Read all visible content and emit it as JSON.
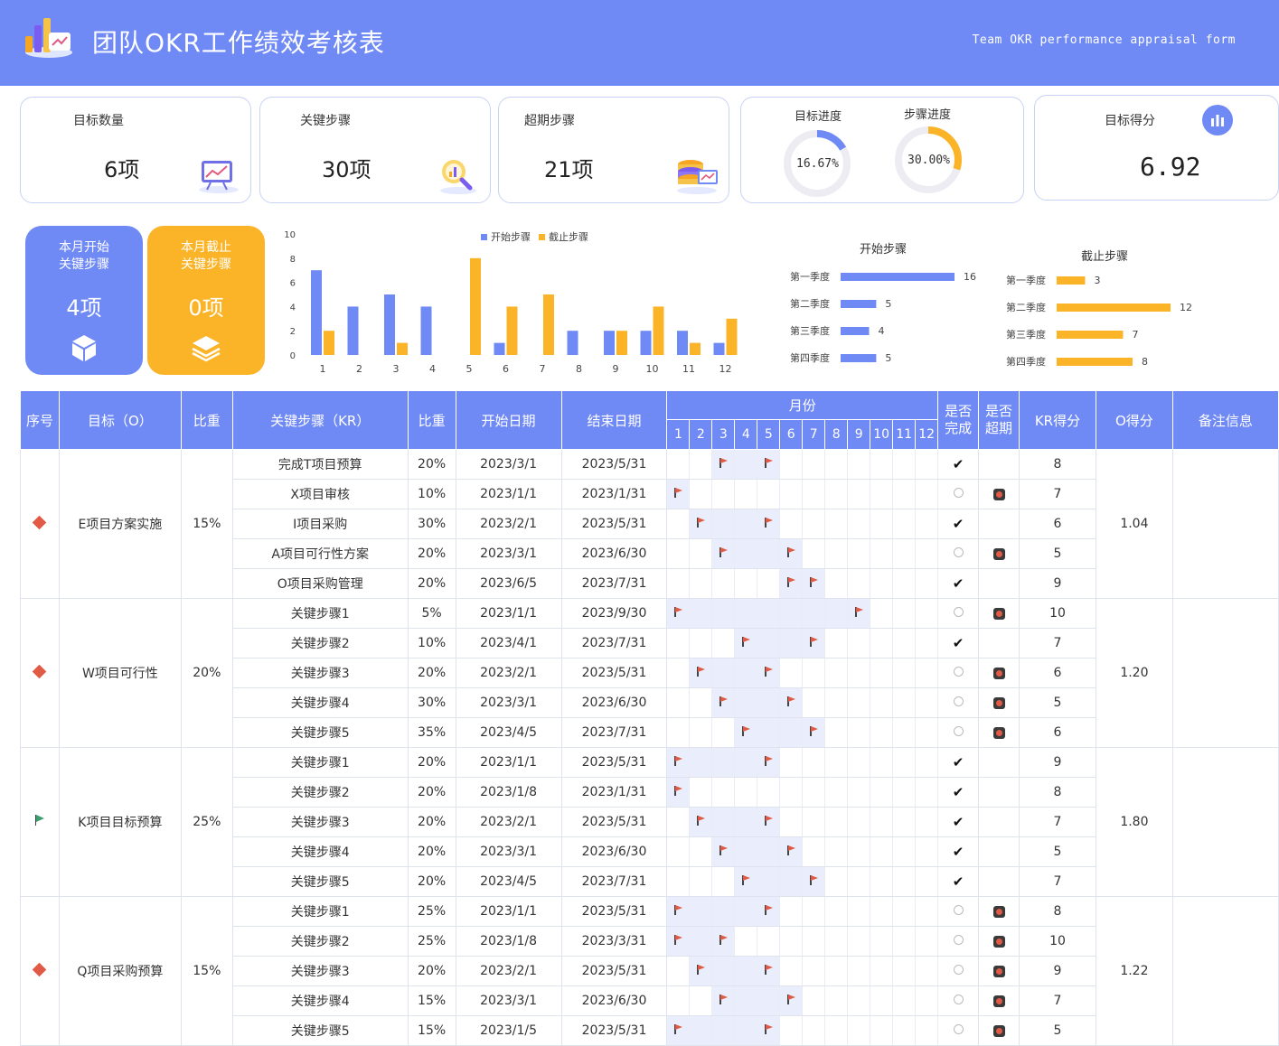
{
  "header": {
    "title": "团队OKR工作绩效考核表",
    "subtitle": "Team OKR performance appraisal form"
  },
  "stats": {
    "goal_count": {
      "label": "目标数量",
      "value": "6项"
    },
    "key_steps": {
      "label": "关键步骤",
      "value": "30项"
    },
    "overdue_steps": {
      "label": "超期步骤",
      "value": "21项"
    },
    "goal_progress": {
      "label": "目标进度",
      "value": "16.67%",
      "fraction": 0.1667
    },
    "step_progress": {
      "label": "步骤进度",
      "value": "30.00%",
      "fraction": 0.3
    },
    "goal_score": {
      "label": "目标得分",
      "value": "6.92"
    }
  },
  "month_boxes": {
    "start": {
      "label1": "本月开始",
      "label2": "关键步骤",
      "value": "4项"
    },
    "end": {
      "label1": "本月截止",
      "label2": "关键步骤",
      "value": "0项"
    }
  },
  "chart_data": [
    {
      "type": "bar",
      "categories": [
        "1",
        "2",
        "3",
        "4",
        "5",
        "6",
        "7",
        "8",
        "9",
        "10",
        "11",
        "12"
      ],
      "series": [
        {
          "name": "开始步骤",
          "values": [
            7,
            4,
            5,
            4,
            0,
            1,
            0,
            2,
            2,
            2,
            2,
            1
          ]
        },
        {
          "name": "截止步骤",
          "values": [
            2,
            0,
            1,
            0,
            8,
            4,
            5,
            0,
            2,
            4,
            1,
            3
          ]
        }
      ],
      "ylim": [
        0,
        10
      ],
      "yticks": [
        "10",
        "8",
        "6",
        "4",
        "2",
        "0"
      ],
      "legend": "top",
      "colors": [
        "#6f89f5",
        "#fbb428"
      ]
    },
    {
      "type": "bar",
      "orientation": "horizontal",
      "title": "开始步骤",
      "categories": [
        "第一季度",
        "第二季度",
        "第三季度",
        "第四季度"
      ],
      "values": [
        16,
        5,
        4,
        5
      ],
      "color": "#6f89f5"
    },
    {
      "type": "bar",
      "orientation": "horizontal",
      "title": "截止步骤",
      "categories": [
        "第一季度",
        "第二季度",
        "第三季度",
        "第四季度"
      ],
      "values": [
        3,
        12,
        7,
        8
      ],
      "color": "#fbb428"
    }
  ],
  "table": {
    "headers": {
      "no": "序号",
      "goal": "目标（O）",
      "weight": "比重",
      "kr": "关键步骤（KR）",
      "kr_weight": "比重",
      "start": "开始日期",
      "end": "结束日期",
      "month": "月份",
      "done": "是否完成",
      "over": "是否超期",
      "kr_score": "KR得分",
      "o_score": "O得分",
      "note": "备注信息"
    },
    "months": [
      "1",
      "2",
      "3",
      "4",
      "5",
      "6",
      "7",
      "8",
      "9",
      "10",
      "11",
      "12"
    ],
    "goals": [
      {
        "status": "diamond",
        "name": "E项目方案实施",
        "weight": "15%",
        "score": "1.04",
        "rows": [
          {
            "kr": "完成T项目预算",
            "w": "20%",
            "start": "2023/3/1",
            "end": "2023/5/31",
            "s": 3,
            "e": 5,
            "done": true,
            "over": false,
            "score": "8"
          },
          {
            "kr": "X项目审核",
            "w": "10%",
            "start": "2023/1/1",
            "end": "2023/1/31",
            "s": 1,
            "e": 1,
            "done": false,
            "over": true,
            "score": "7"
          },
          {
            "kr": "I项目采购",
            "w": "30%",
            "start": "2023/2/1",
            "end": "2023/5/31",
            "s": 2,
            "e": 5,
            "done": true,
            "over": false,
            "score": "6"
          },
          {
            "kr": "A项目可行性方案",
            "w": "20%",
            "start": "2023/3/1",
            "end": "2023/6/30",
            "s": 3,
            "e": 6,
            "done": false,
            "over": true,
            "score": "5"
          },
          {
            "kr": "O项目采购管理",
            "w": "20%",
            "start": "2023/6/5",
            "end": "2023/7/31",
            "s": 6,
            "e": 7,
            "done": true,
            "over": false,
            "score": "9"
          }
        ]
      },
      {
        "status": "diamond",
        "name": "W项目可行性",
        "weight": "20%",
        "score": "1.20",
        "rows": [
          {
            "kr": "关键步骤1",
            "w": "5%",
            "start": "2023/1/1",
            "end": "2023/9/30",
            "s": 1,
            "e": 9,
            "done": false,
            "over": true,
            "score": "10"
          },
          {
            "kr": "关键步骤2",
            "w": "10%",
            "start": "2023/4/1",
            "end": "2023/7/31",
            "s": 4,
            "e": 7,
            "done": true,
            "over": false,
            "score": "7"
          },
          {
            "kr": "关键步骤3",
            "w": "20%",
            "start": "2023/2/1",
            "end": "2023/5/31",
            "s": 2,
            "e": 5,
            "done": false,
            "over": true,
            "score": "6"
          },
          {
            "kr": "关键步骤4",
            "w": "30%",
            "start": "2023/3/1",
            "end": "2023/6/30",
            "s": 3,
            "e": 6,
            "done": false,
            "over": true,
            "score": "5"
          },
          {
            "kr": "关键步骤5",
            "w": "35%",
            "start": "2023/4/5",
            "end": "2023/7/31",
            "s": 4,
            "e": 7,
            "done": false,
            "over": true,
            "score": "6"
          }
        ]
      },
      {
        "status": "flag",
        "name": "K项目目标预算",
        "weight": "25%",
        "score": "1.80",
        "rows": [
          {
            "kr": "关键步骤1",
            "w": "20%",
            "start": "2023/1/1",
            "end": "2023/5/31",
            "s": 1,
            "e": 5,
            "done": true,
            "over": false,
            "score": "9"
          },
          {
            "kr": "关键步骤2",
            "w": "20%",
            "start": "2023/1/8",
            "end": "2023/1/31",
            "s": 1,
            "e": 1,
            "done": true,
            "over": false,
            "score": "8"
          },
          {
            "kr": "关键步骤3",
            "w": "20%",
            "start": "2023/2/1",
            "end": "2023/5/31",
            "s": 2,
            "e": 5,
            "done": true,
            "over": false,
            "score": "7"
          },
          {
            "kr": "关键步骤4",
            "w": "20%",
            "start": "2023/3/1",
            "end": "2023/6/30",
            "s": 3,
            "e": 6,
            "done": true,
            "over": false,
            "score": "5"
          },
          {
            "kr": "关键步骤5",
            "w": "20%",
            "start": "2023/4/5",
            "end": "2023/7/31",
            "s": 4,
            "e": 7,
            "done": true,
            "over": false,
            "score": "7"
          }
        ]
      },
      {
        "status": "diamond",
        "name": "Q项目采购预算",
        "weight": "15%",
        "score": "1.22",
        "rows": [
          {
            "kr": "关键步骤1",
            "w": "25%",
            "start": "2023/1/1",
            "end": "2023/5/31",
            "s": 1,
            "e": 5,
            "done": false,
            "over": true,
            "score": "8"
          },
          {
            "kr": "关键步骤2",
            "w": "25%",
            "start": "2023/1/8",
            "end": "2023/3/31",
            "s": 1,
            "e": 3,
            "done": false,
            "over": true,
            "score": "10"
          },
          {
            "kr": "关键步骤3",
            "w": "20%",
            "start": "2023/2/1",
            "end": "2023/5/31",
            "s": 2,
            "e": 5,
            "done": false,
            "over": true,
            "score": "9"
          },
          {
            "kr": "关键步骤4",
            "w": "15%",
            "start": "2023/3/1",
            "end": "2023/6/30",
            "s": 3,
            "e": 6,
            "done": false,
            "over": true,
            "score": "7"
          },
          {
            "kr": "关键步骤5",
            "w": "15%",
            "start": "2023/1/5",
            "end": "2023/5/31",
            "s": 1,
            "e": 5,
            "done": false,
            "over": true,
            "score": "5"
          }
        ]
      }
    ]
  }
}
